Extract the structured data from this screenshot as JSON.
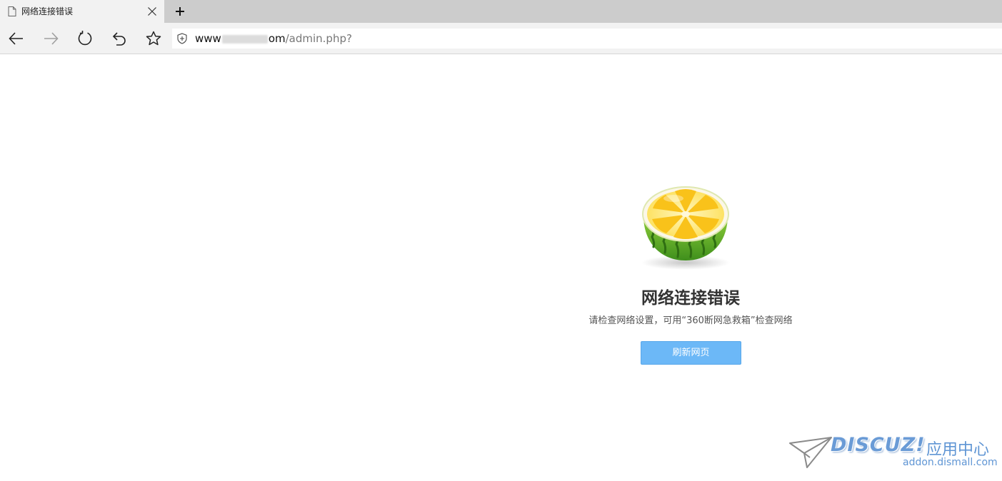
{
  "tab": {
    "title": "网络连接错误",
    "icon": "page-icon",
    "close_icon": "close-icon"
  },
  "newtab": {
    "icon": "plus-icon"
  },
  "toolbar": {
    "back_icon": "arrow-left-icon",
    "forward_icon": "arrow-right-icon",
    "refresh_icon": "refresh-icon",
    "undo_icon": "undo-icon",
    "favorite_icon": "star-icon"
  },
  "address": {
    "security_icon": "shield-icon",
    "host_visible_start": "www",
    "host_visible_end": "om",
    "path": "/admin.php?"
  },
  "error": {
    "illustration": "melon-illustration",
    "title": "网络连接错误",
    "description": "请检查网络设置，可用“360断网急救箱”检查网络",
    "button_label": "刷新网页"
  },
  "watermark": {
    "logo": "DISCUZ!",
    "subtitle": "应用中心",
    "domain": "addon.dismall.com"
  },
  "colors": {
    "tab_strip": "#cccccc",
    "toolbar": "#f2f2f2",
    "button": "#6cb8f7",
    "watermark": "#6a9bd6"
  }
}
